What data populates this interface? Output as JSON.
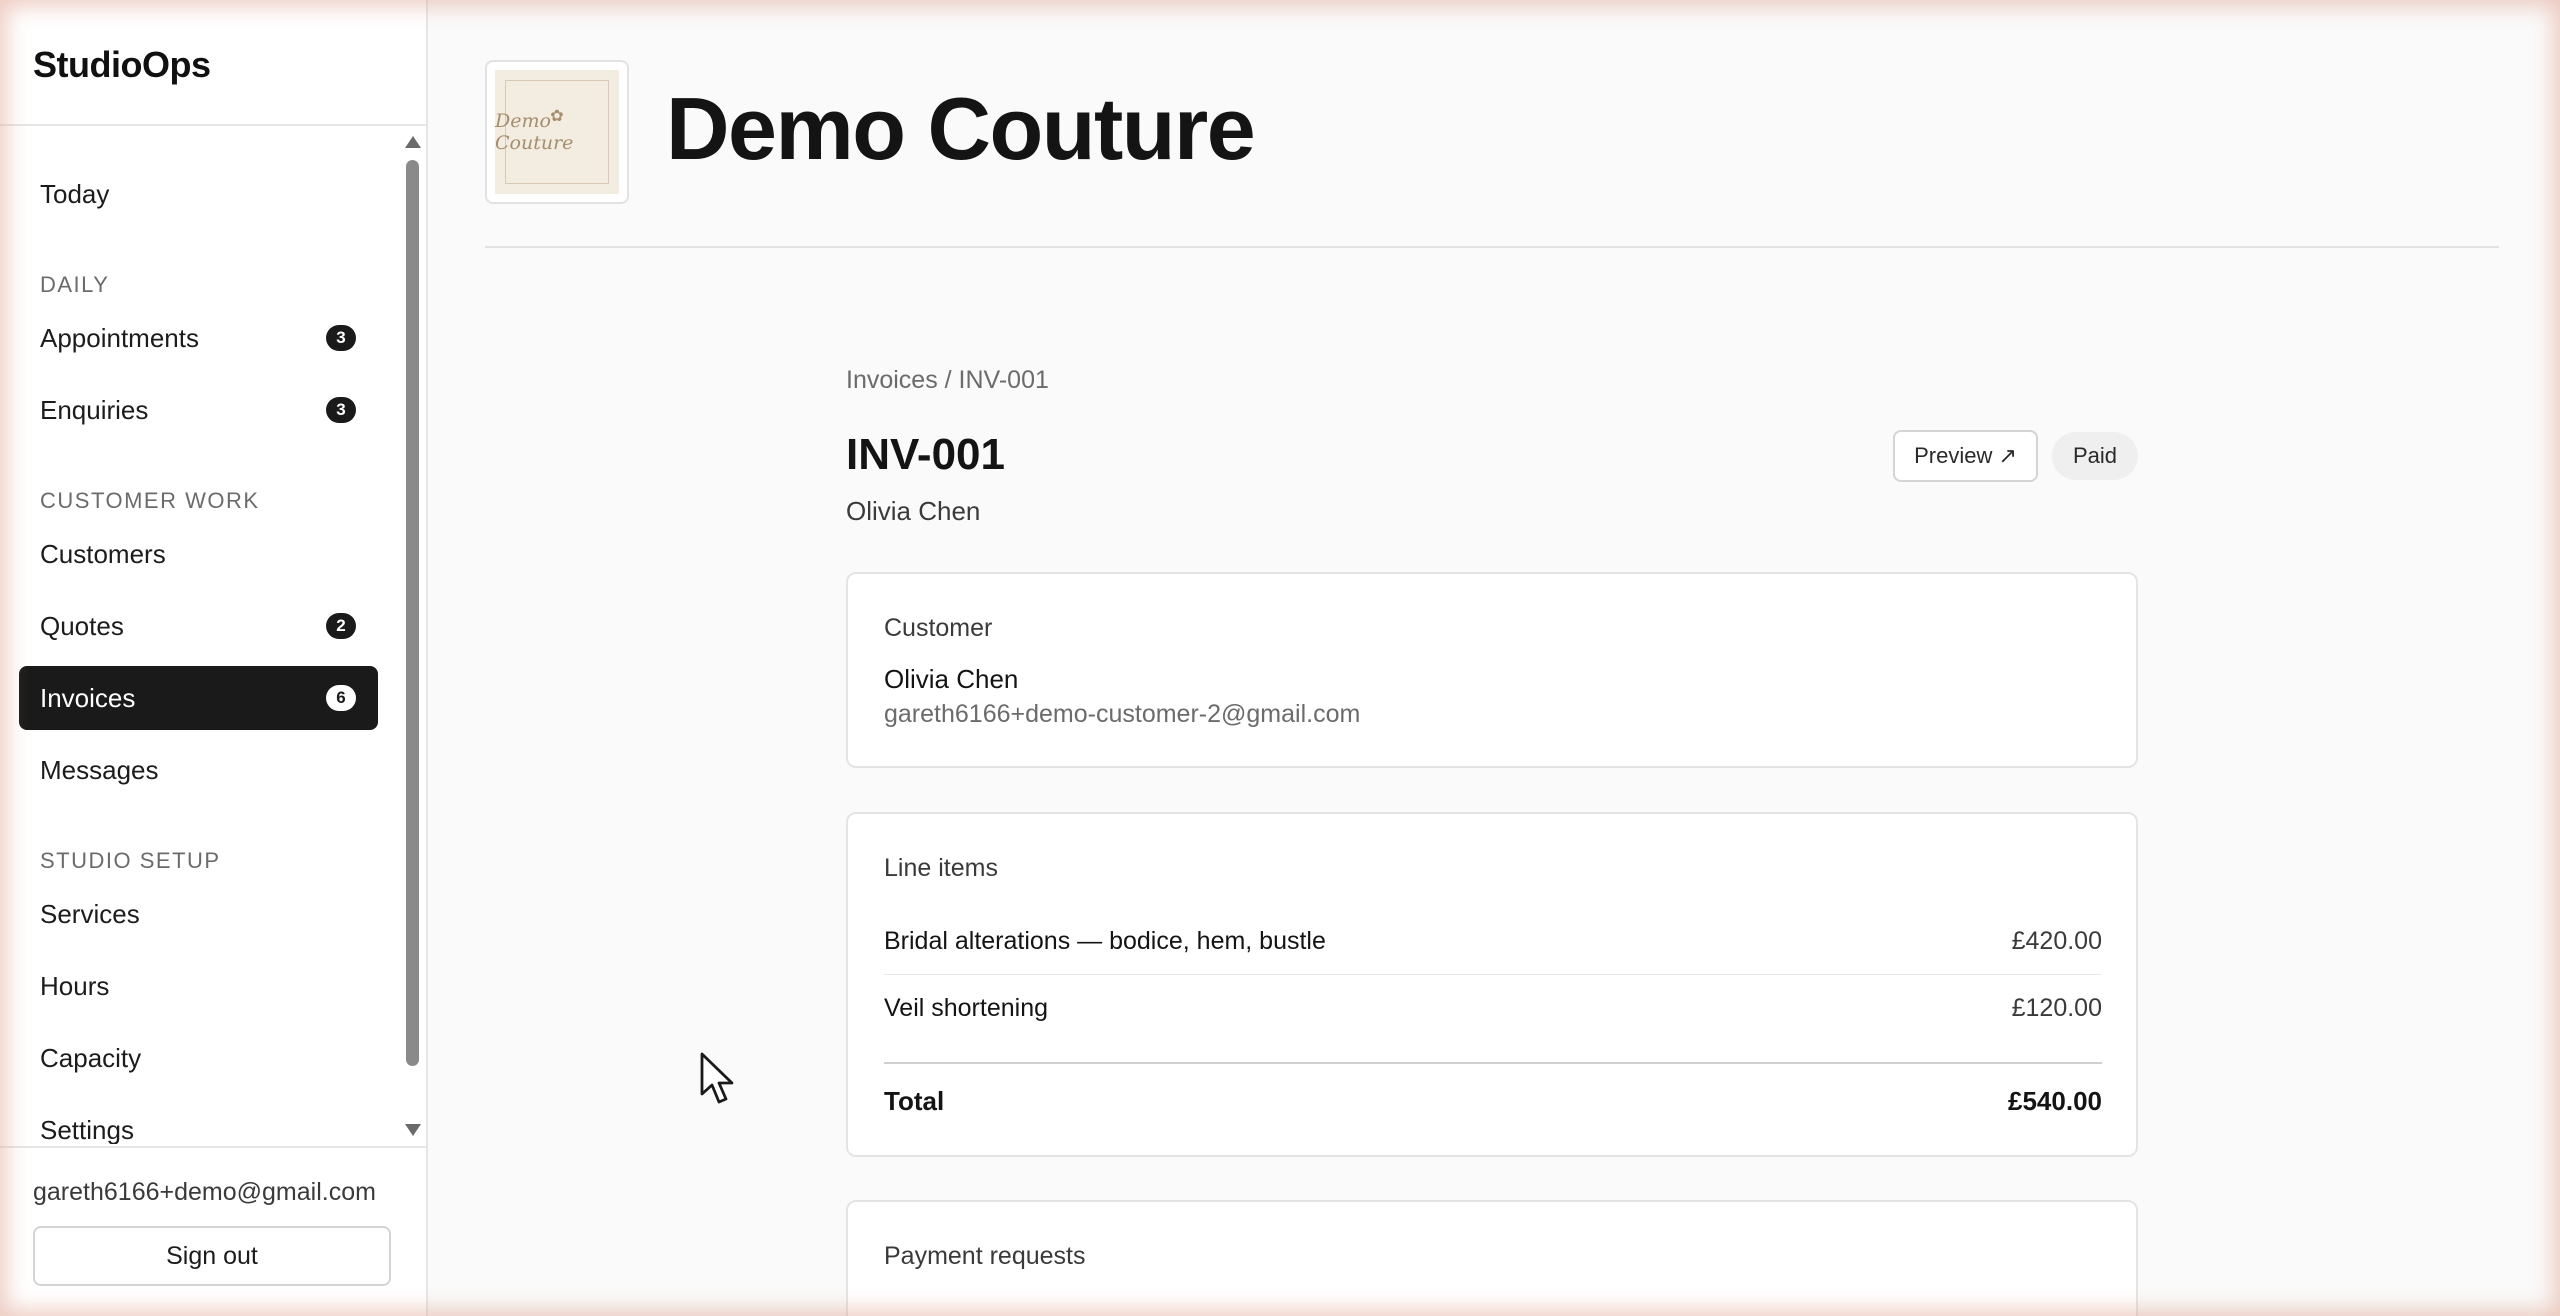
{
  "app": {
    "name": "StudioOps"
  },
  "sidebar": {
    "items": {
      "today": {
        "label": "Today"
      },
      "appointments": {
        "label": "Appointments",
        "badge": "3"
      },
      "enquiries": {
        "label": "Enquiries",
        "badge": "3"
      },
      "customers": {
        "label": "Customers"
      },
      "quotes": {
        "label": "Quotes",
        "badge": "2"
      },
      "invoices": {
        "label": "Invoices",
        "badge": "6",
        "active": true
      },
      "messages": {
        "label": "Messages"
      },
      "services": {
        "label": "Services"
      },
      "hours": {
        "label": "Hours"
      },
      "capacity": {
        "label": "Capacity"
      },
      "settings": {
        "label": "Settings"
      }
    },
    "sections": {
      "daily": "DAILY",
      "customer_work": "CUSTOMER WORK",
      "studio_setup": "STUDIO SETUP"
    },
    "user_email": "gareth6166+demo@gmail.com",
    "sign_out_label": "Sign out"
  },
  "header": {
    "studio_name": "Demo Couture",
    "logo_text": "Demo Couture",
    "logo_icon": "flower-icon"
  },
  "invoice": {
    "breadcrumb": "Invoices / INV-001",
    "number": "INV-001",
    "customer_name": "Olivia Chen",
    "preview_label": "Preview ↗",
    "status": "Paid",
    "customer_card": {
      "title": "Customer",
      "name": "Olivia Chen",
      "email": "gareth6166+demo-customer-2@gmail.com"
    },
    "line_items_card": {
      "title": "Line items",
      "items": [
        {
          "description": "Bridal alterations — bodice, hem, bustle",
          "amount": "£420.00"
        },
        {
          "description": "Veil shortening",
          "amount": "£120.00"
        }
      ],
      "total_label": "Total",
      "total_amount": "£540.00"
    },
    "payment_requests_card": {
      "title": "Payment requests"
    }
  },
  "colors": {
    "accent": "#1a1a1a",
    "frame_glow": "#dea08c",
    "logo_background": "#f3ece1"
  }
}
